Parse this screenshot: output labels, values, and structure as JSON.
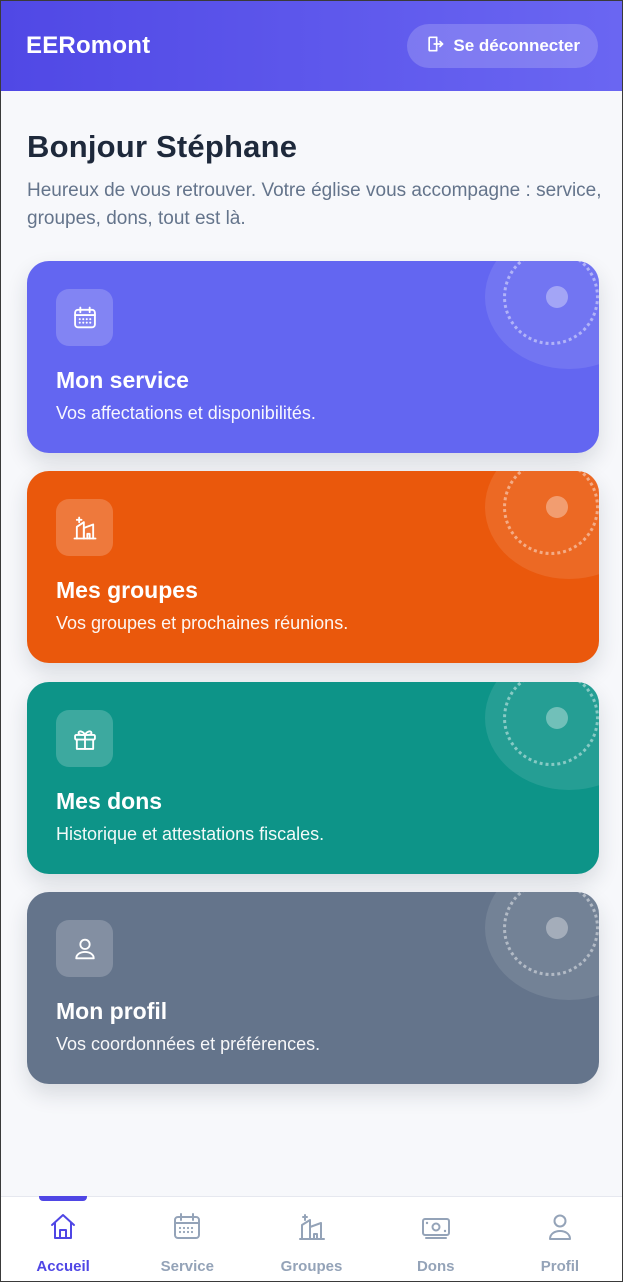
{
  "header": {
    "app_title": "EERomont",
    "logout_label": "Se déconnecter"
  },
  "greeting": {
    "title": "Bonjour Stéphane",
    "subtitle": "Heureux de vous retrouver. Votre église vous accompagne : service, groupes, dons, tout est là."
  },
  "cards": [
    {
      "title": "Mon service",
      "description": "Vos affectations et disponibilités.",
      "icon": "calendar-icon",
      "color": "#6366f1"
    },
    {
      "title": "Mes groupes",
      "description": "Vos groupes et prochaines réunions.",
      "icon": "church-icon",
      "color": "#ea580c"
    },
    {
      "title": "Mes dons",
      "description": "Historique et attestations fiscales.",
      "icon": "gift-icon",
      "color": "#0d9488"
    },
    {
      "title": "Mon profil",
      "description": "Vos coordonnées et préférences.",
      "icon": "user-icon",
      "color": "#64748b"
    }
  ],
  "nav": {
    "items": [
      {
        "label": "Accueil",
        "icon": "home-icon",
        "active": true
      },
      {
        "label": "Service",
        "icon": "calendar-icon",
        "active": false
      },
      {
        "label": "Groupes",
        "icon": "church-icon",
        "active": false
      },
      {
        "label": "Dons",
        "icon": "money-icon",
        "active": false
      },
      {
        "label": "Profil",
        "icon": "user-icon",
        "active": false
      }
    ],
    "active_color": "#4f46e5",
    "inactive_color": "#94a3b8"
  }
}
